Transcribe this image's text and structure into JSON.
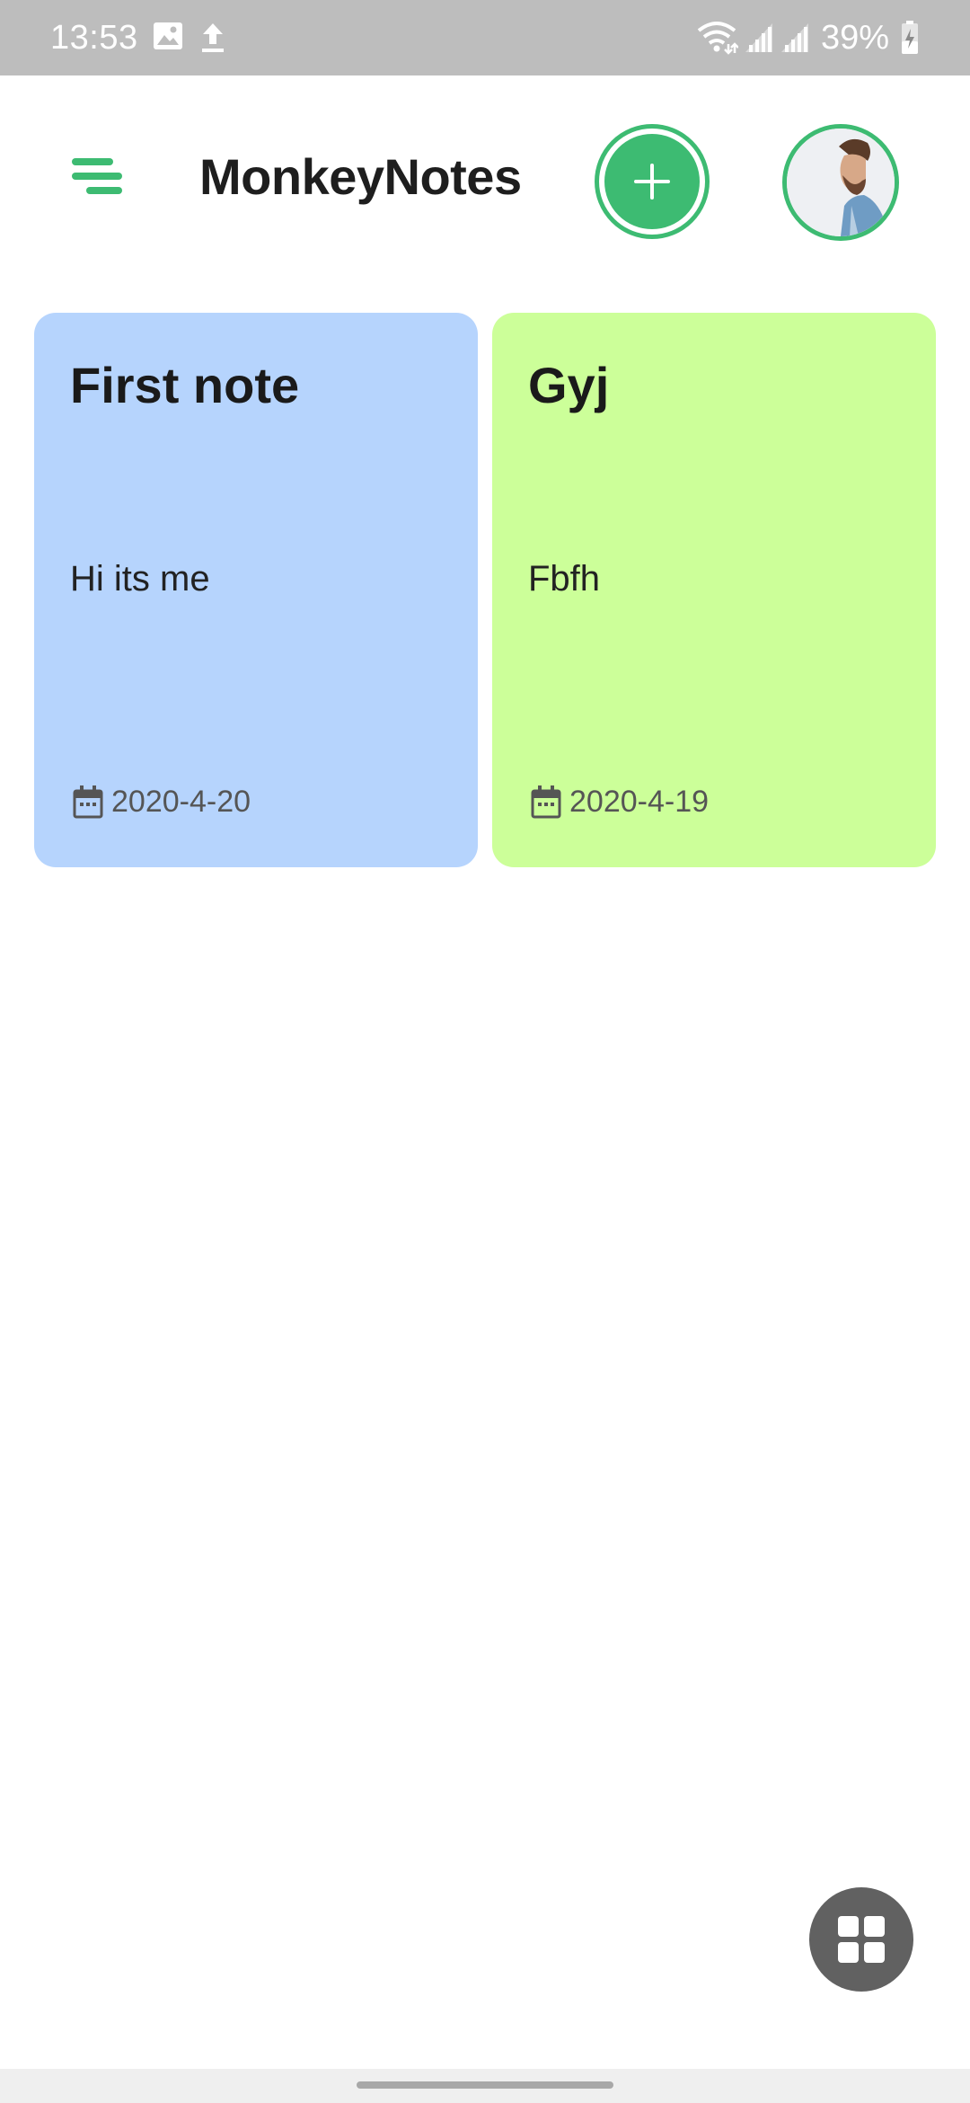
{
  "status_bar": {
    "time": "13:53",
    "battery": "39%",
    "icons": [
      "image-icon",
      "upload-icon",
      "wifi-icon",
      "signal-icon",
      "signal-icon",
      "battery-charging-icon"
    ]
  },
  "header": {
    "title": "MonkeyNotes",
    "menu_icon": "menu-icon",
    "add_icon": "plus-icon",
    "avatar_icon": "avatar",
    "accent_color": "#3dbb72"
  },
  "notes": [
    {
      "title": "First note",
      "body": "Hi its me",
      "date": "2020-4-20",
      "color": "#b6d4fd"
    },
    {
      "title": "Gyj",
      "body": "Fbfh",
      "date": "2020-4-19",
      "color": "#ccff99"
    }
  ],
  "fab": {
    "icon": "grid-view-icon",
    "color": "#616161"
  }
}
